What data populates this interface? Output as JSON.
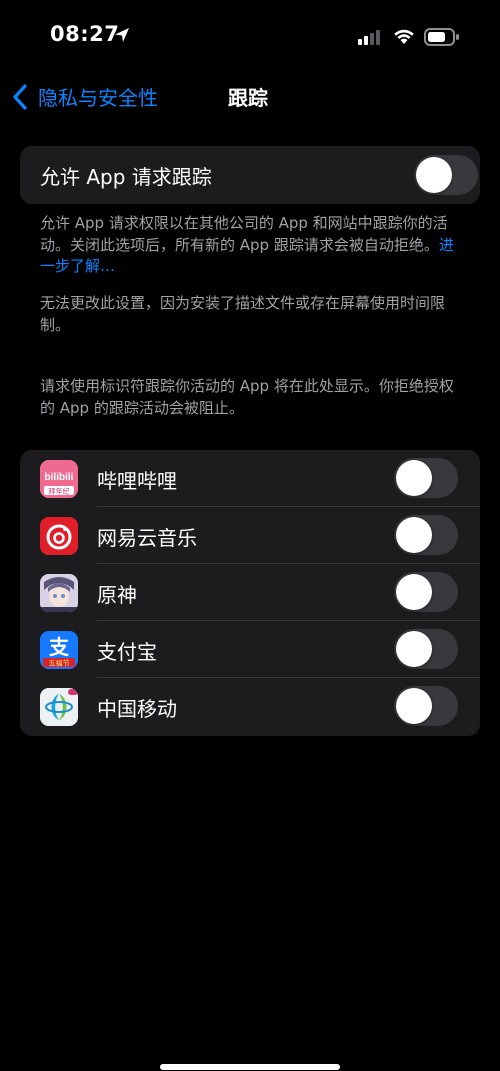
{
  "status_bar": {
    "time": "08:27"
  },
  "nav": {
    "back_label": "隐私与安全性",
    "title": "跟踪"
  },
  "main_toggle": {
    "label": "允许 App 请求跟踪",
    "enabled": false
  },
  "description": {
    "part1": "允许 App 请求权限以在其他公司的 App 和网站中跟踪你的活动。关闭此选项后，所有新的 App 跟踪请求会被自动拒绝。",
    "learn_more": "进一步了解…",
    "restriction": "无法更改此设置，因为安装了描述文件或存在屏幕使用时间限制。",
    "apps_header": "请求使用标识符跟踪你活动的 App 将在此处显示。你拒绝授权的 App 的跟踪活动会被阻止。"
  },
  "apps": [
    {
      "name": "哔哩哔哩",
      "icon": "bilibili-icon",
      "icon_text": "bilibili",
      "icon_subtext": "拜年纪",
      "enabled": false
    },
    {
      "name": "网易云音乐",
      "icon": "netease-music-icon",
      "enabled": false
    },
    {
      "name": "原神",
      "icon": "genshin-icon",
      "enabled": false
    },
    {
      "name": "支付宝",
      "icon": "alipay-icon",
      "icon_text": "支",
      "icon_subtext": "五福节",
      "enabled": false
    },
    {
      "name": "中国移动",
      "icon": "china-mobile-icon",
      "enabled": false
    }
  ],
  "colors": {
    "accent": "#0a84ff",
    "cell_bg": "#1c1c1e",
    "toggle_off": "#39393d",
    "secondary_text": "#a1a1a6"
  }
}
